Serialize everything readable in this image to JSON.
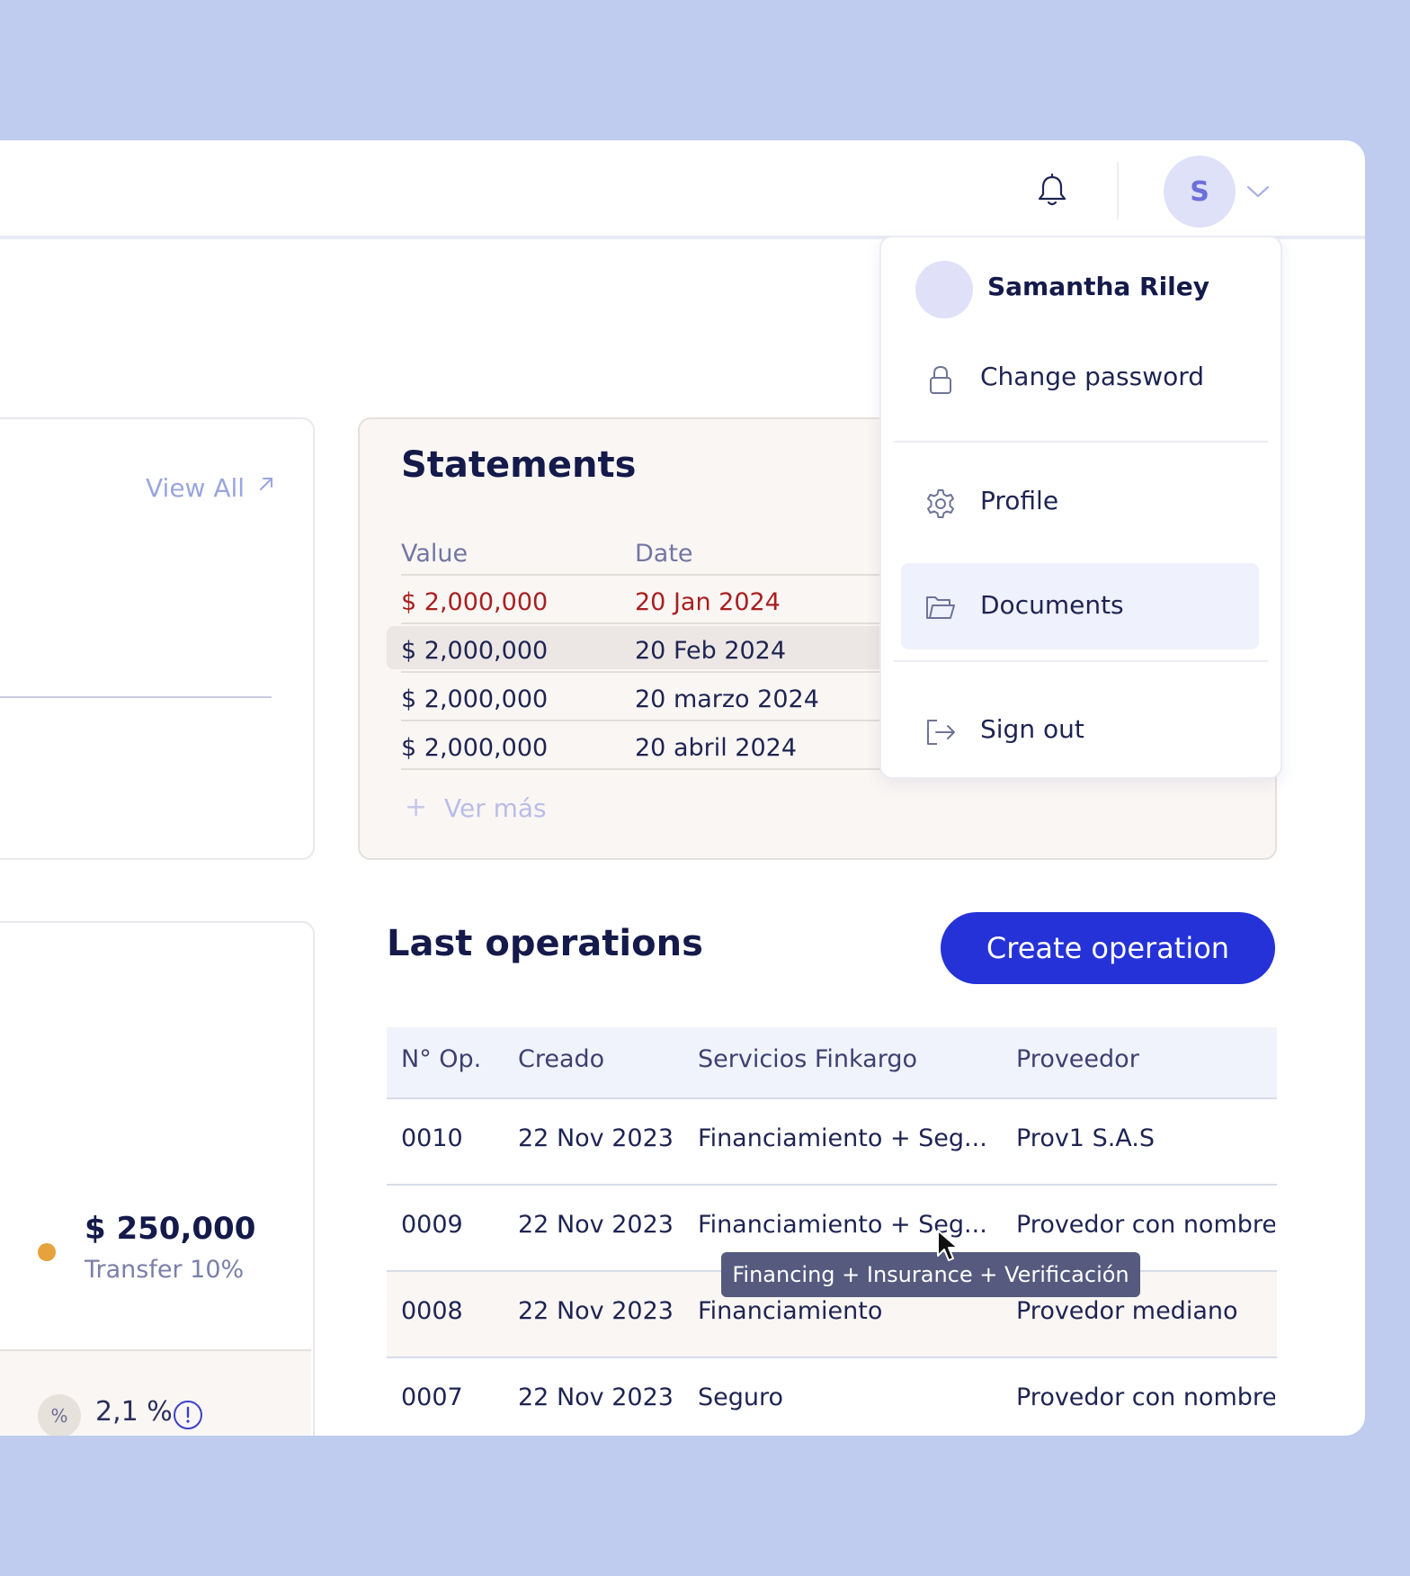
{
  "header": {
    "bell_icon": "bell-icon",
    "avatar_initial": "S",
    "chevron_icon": "chevron-down-icon"
  },
  "left_card": {
    "view_all": "View All"
  },
  "statements": {
    "title": "Statements",
    "columns": [
      "Value",
      "Date"
    ],
    "rows": [
      {
        "value": "$ 2,000,000",
        "date": "20 Jan 2024",
        "highlight": "red"
      },
      {
        "value": "$ 2,000,000",
        "date": "20 Feb 2024"
      },
      {
        "value": "$ 2,000,000",
        "date": "20 marzo 2024"
      },
      {
        "value": "$ 2,000,000",
        "date": "20 abril 2024"
      }
    ],
    "ver_mas": "Ver más"
  },
  "user_menu": {
    "name": "Samantha Riley",
    "items": [
      {
        "label": "Change password",
        "icon": "lock-icon"
      },
      {
        "label": "Profile",
        "icon": "gear-icon"
      },
      {
        "label": "Documents",
        "icon": "folder-icon",
        "active": true
      },
      {
        "label": "Sign out",
        "icon": "sign-out-icon"
      }
    ]
  },
  "operations": {
    "title": "Last operations",
    "create_button": "Create operation",
    "columns": [
      "N° Op.",
      "Creado",
      "Servicios Finkargo",
      "Proveedor"
    ],
    "rows": [
      {
        "op": "0010",
        "created": "22 Nov 2023",
        "services": "Financiamiento + Seg...",
        "provider": "Prov1 S.A.S"
      },
      {
        "op": "0009",
        "created": "22 Nov 2023",
        "services": "Financiamiento + Seg...",
        "provider": "Provedor con nombre"
      },
      {
        "op": "0008",
        "created": "22 Nov 2023",
        "services": "Financiamiento",
        "provider": "Provedor mediano"
      },
      {
        "op": "0007",
        "created": "22 Nov 2023",
        "services": "Seguro",
        "provider": "Provedor con nombre"
      }
    ],
    "tooltip": "Financing + Insurance + Verificación"
  },
  "summary_card": {
    "amount": "$ 250,000",
    "transfer": "Transfer 10%",
    "percent_symbol": "%",
    "percent_value": "2,1 %",
    "dot_color": "#e6a23c"
  },
  "colors": {
    "background": "#bfcbef",
    "primary": "#2532d8",
    "danger": "#a81f1f"
  }
}
